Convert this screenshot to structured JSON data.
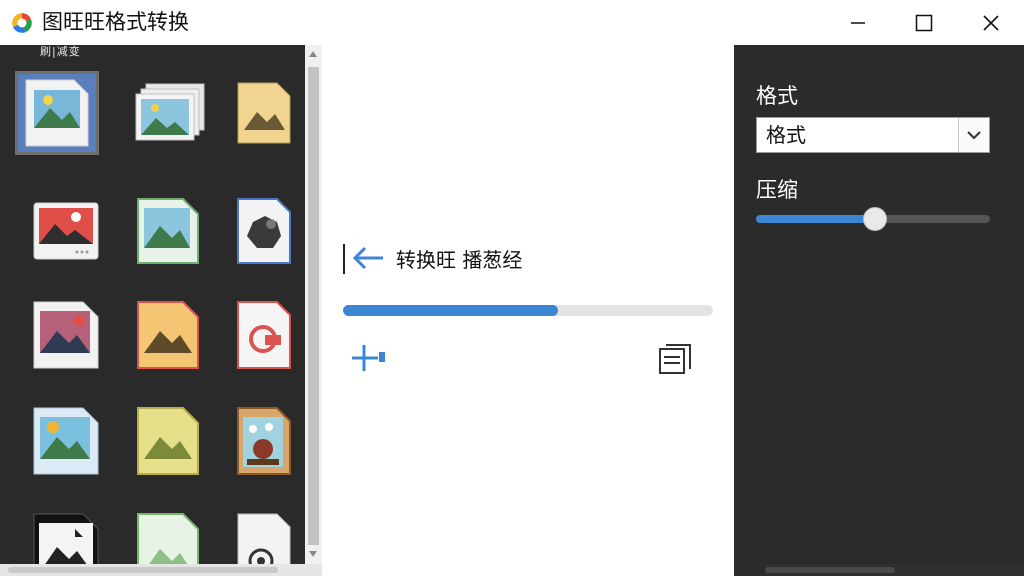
{
  "window": {
    "title": "图旺旺格式转换",
    "controls": [
      "minimize-icon",
      "maximize-icon",
      "close-icon"
    ]
  },
  "left_panel": {
    "header": "刷|减变",
    "thumbnails": [
      {
        "icon": "image-file-icon",
        "selected": true
      },
      {
        "icon": "image-stack-icon",
        "selected": false
      },
      {
        "icon": "image-file-icon",
        "selected": false
      },
      {
        "icon": "image-file-icon",
        "selected": false
      },
      {
        "icon": "image-file-icon",
        "selected": false
      },
      {
        "icon": "rock-file-icon",
        "selected": false
      },
      {
        "icon": "image-file-icon",
        "selected": false
      },
      {
        "icon": "image-file-icon",
        "selected": false
      },
      {
        "icon": "camera-file-icon",
        "selected": false
      },
      {
        "icon": "image-file-icon",
        "selected": false
      },
      {
        "icon": "image-file-icon",
        "selected": false
      },
      {
        "icon": "illustration-file-icon",
        "selected": false
      },
      {
        "icon": "image-file-icon",
        "selected": false
      },
      {
        "icon": "image-file-icon",
        "selected": false
      },
      {
        "icon": "gear-file-icon",
        "selected": false
      }
    ]
  },
  "center": {
    "status_text": "转换旺  播葱经",
    "progress": 0.58
  },
  "right_panel": {
    "format_label": "格式",
    "format_value": "格式",
    "compress_label": "压缩",
    "compress_value": 0.51
  },
  "colors": {
    "accent": "#3d86d6",
    "dark_panel": "#2a2a2a",
    "selected_thumb": "#5a7fbf"
  }
}
